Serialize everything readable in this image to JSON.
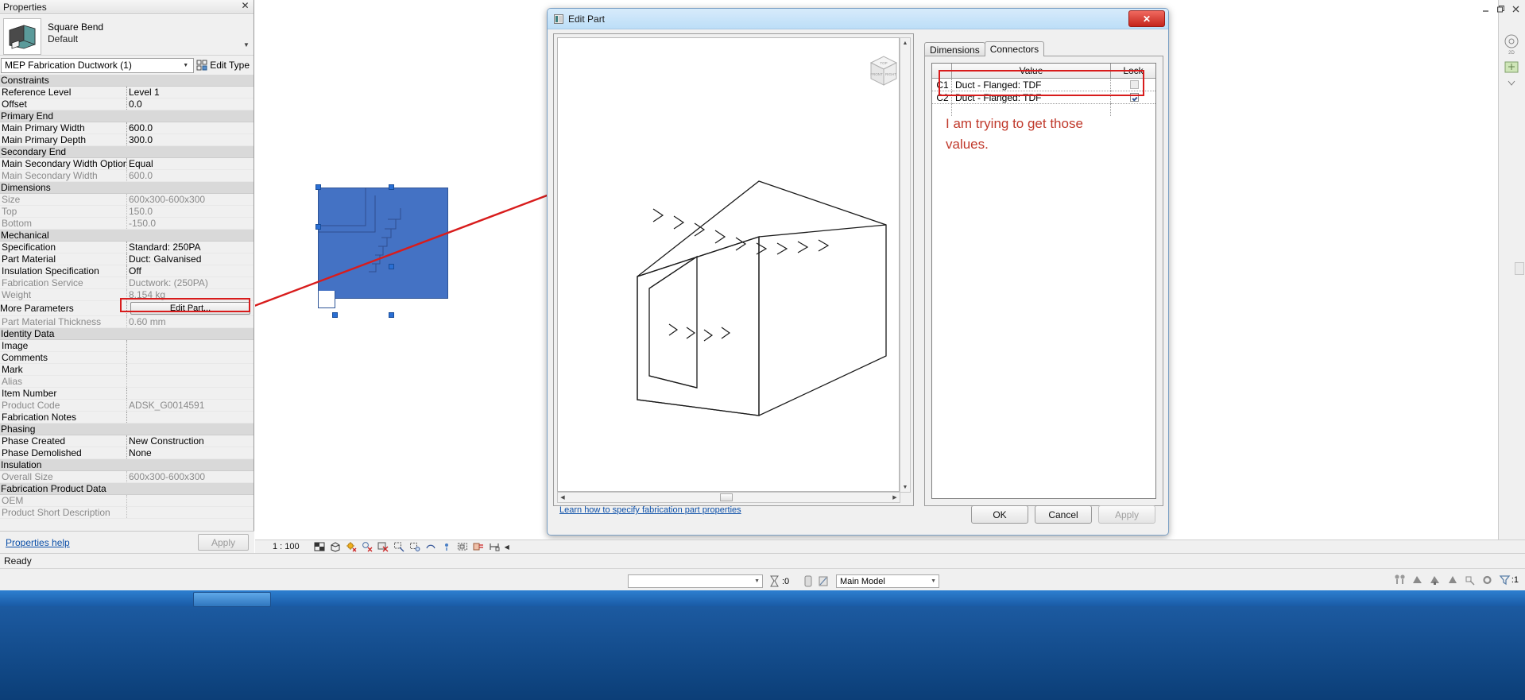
{
  "properties_panel": {
    "title": "Properties",
    "close_icon": "close-icon",
    "type_name": "Square Bend",
    "type_variant": "Default",
    "selector_value": "MEP Fabrication Ductwork (1)",
    "edit_type_label": "Edit Type",
    "help_link": "Properties help",
    "apply_label": "Apply",
    "edit_part_button": "Edit Part...",
    "groups": [
      {
        "name": "Constraints",
        "rows": [
          {
            "key": "Reference Level",
            "value": "Level 1",
            "readonly": false
          },
          {
            "key": "Offset",
            "value": "0.0",
            "readonly": false
          }
        ]
      },
      {
        "name": "Primary End",
        "rows": [
          {
            "key": "Main Primary Width",
            "value": "600.0",
            "readonly": false
          },
          {
            "key": "Main Primary Depth",
            "value": "300.0",
            "readonly": false
          }
        ]
      },
      {
        "name": "Secondary End",
        "rows": [
          {
            "key": "Main Secondary Width Option",
            "value": "Equal",
            "readonly": false
          },
          {
            "key": "Main Secondary Width",
            "value": "600.0",
            "readonly": true
          }
        ]
      },
      {
        "name": "Dimensions",
        "rows": [
          {
            "key": "Size",
            "value": "600x300-600x300",
            "readonly": true
          },
          {
            "key": "Top",
            "value": "150.0",
            "readonly": true
          },
          {
            "key": "Bottom",
            "value": "-150.0",
            "readonly": true
          }
        ]
      },
      {
        "name": "Mechanical",
        "rows": [
          {
            "key": "Specification",
            "value": "Standard: 250PA",
            "readonly": false
          },
          {
            "key": "Part Material",
            "value": "Duct: Galvanised",
            "readonly": false
          },
          {
            "key": "Insulation Specification",
            "value": "Off",
            "readonly": false
          },
          {
            "key": "Fabrication Service",
            "value": "Ductwork: (250PA)",
            "readonly": true
          },
          {
            "key": "Weight",
            "value": "8.154 kg",
            "readonly": true
          },
          {
            "key": "More Parameters",
            "value": "",
            "readonly": false,
            "button": true
          },
          {
            "key": "Part Material Thickness",
            "value": "0.60 mm",
            "readonly": true
          }
        ]
      },
      {
        "name": "Identity Data",
        "rows": [
          {
            "key": "Image",
            "value": "",
            "readonly": false
          },
          {
            "key": "Comments",
            "value": "",
            "readonly": false
          },
          {
            "key": "Mark",
            "value": "",
            "readonly": false
          },
          {
            "key": "Alias",
            "value": "",
            "readonly": true
          },
          {
            "key": "Item Number",
            "value": "",
            "readonly": false
          },
          {
            "key": "Product Code",
            "value": "ADSK_G0014591",
            "readonly": true
          },
          {
            "key": "Fabrication Notes",
            "value": "",
            "readonly": false
          }
        ]
      },
      {
        "name": "Phasing",
        "rows": [
          {
            "key": "Phase Created",
            "value": "New Construction",
            "readonly": false
          },
          {
            "key": "Phase Demolished",
            "value": "None",
            "readonly": false
          }
        ]
      },
      {
        "name": "Insulation",
        "rows": [
          {
            "key": "Overall Size",
            "value": "600x300-600x300",
            "readonly": true
          }
        ]
      },
      {
        "name": "Fabrication Product Data",
        "rows": [
          {
            "key": "OEM",
            "value": "",
            "readonly": true
          },
          {
            "key": "Product Short Description",
            "value": "",
            "readonly": true
          }
        ]
      }
    ]
  },
  "dialog": {
    "title": "Edit Part",
    "icon": "edit-part-icon",
    "close_label": "✕",
    "tabs": [
      {
        "label": "Dimensions",
        "active": false
      },
      {
        "label": "Connectors",
        "active": true
      }
    ],
    "table": {
      "columns": [
        "",
        "Value",
        "Lock"
      ],
      "rows": [
        {
          "id": "C1",
          "value": "Duct - Flanged: TDF",
          "locked": false,
          "lock_disabled": true
        },
        {
          "id": "C2",
          "value": "Duct - Flanged: TDF",
          "locked": true,
          "lock_disabled": false
        }
      ]
    },
    "annotation": "I am trying to get those values.",
    "link": "Learn how to specify fabrication part properties",
    "buttons": {
      "ok": "OK",
      "cancel": "Cancel",
      "apply": "Apply"
    },
    "viewcube_faces": {
      "top": "TOP",
      "front": "FRONT",
      "right": "RIGHT"
    }
  },
  "view_control_bar": {
    "scale": "1 : 100",
    "icons": [
      "detail-level-icon",
      "visual-style-icon",
      "sun-path-icon",
      "shadows-icon",
      "rendering-dialog-icon",
      "crop-view-icon",
      "show-crop-region-icon",
      "lock-3d-view-icon",
      "temporary-hide-isolate-icon",
      "reveal-hidden-elements-icon",
      "analytical-model-icon",
      "constraints-icon",
      "more-icon"
    ]
  },
  "status_bar": {
    "message": "Ready",
    "selection_count": ":0",
    "workset": "Main Model",
    "filter_count": ":1",
    "right_icons": [
      "editable-icon",
      "design-option-icon",
      "worksets-icon",
      "exclude-options-icon",
      "select-link-icon",
      "settings-icon",
      "filter-icon"
    ]
  },
  "window_controls": {
    "minimize": "minimize-icon",
    "restore": "restore-icon",
    "close": "close-icon"
  }
}
